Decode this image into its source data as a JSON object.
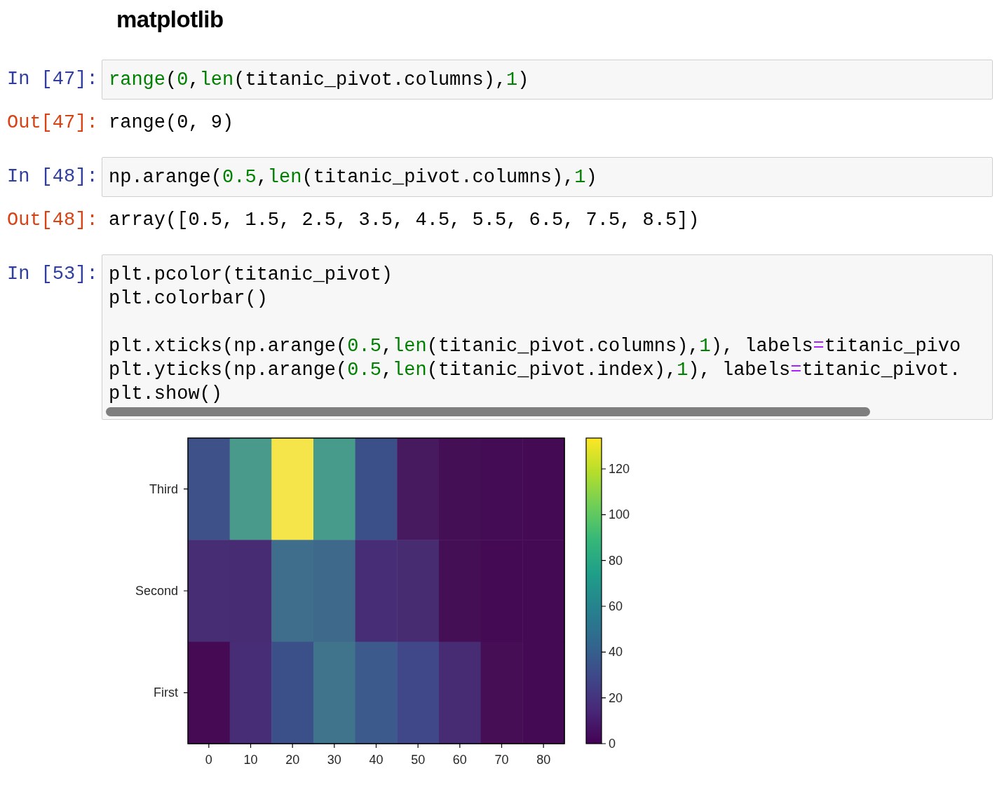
{
  "heading": "matplotlib",
  "cells": [
    {
      "prompt": "In [47]:",
      "code": [
        [
          [
            {
              "kind": "builtin",
              "text": "range"
            },
            {
              "kind": "plain",
              "text": "("
            },
            {
              "kind": "number",
              "text": "0"
            },
            {
              "kind": "plain",
              "text": ","
            },
            {
              "kind": "builtin",
              "text": "len"
            },
            {
              "kind": "plain",
              "text": "(titanic_pivot.columns),"
            },
            {
              "kind": "number",
              "text": "1"
            },
            {
              "kind": "plain",
              "text": ")"
            }
          ]
        ]
      ],
      "out_prompt": "Out[47]:",
      "output": "range(0, 9)"
    },
    {
      "prompt": "In [48]:",
      "code": [
        [
          [
            {
              "kind": "plain",
              "text": "np.arange("
            },
            {
              "kind": "number",
              "text": "0.5"
            },
            {
              "kind": "plain",
              "text": ","
            },
            {
              "kind": "builtin",
              "text": "len"
            },
            {
              "kind": "plain",
              "text": "(titanic_pivot.columns),"
            },
            {
              "kind": "number",
              "text": "1"
            },
            {
              "kind": "plain",
              "text": ")"
            }
          ]
        ]
      ],
      "out_prompt": "Out[48]:",
      "output": "array([0.5, 1.5, 2.5, 3.5, 4.5, 5.5, 6.5, 7.5, 8.5])"
    },
    {
      "prompt": "In [53]:",
      "code": [
        [
          [
            {
              "kind": "plain",
              "text": "plt.pcolor(titanic_pivot)"
            }
          ],
          [
            {
              "kind": "plain",
              "text": "plt.colorbar()"
            }
          ]
        ],
        [
          [
            {
              "kind": "plain",
              "text": "plt.xticks(np.arange("
            },
            {
              "kind": "number",
              "text": "0.5"
            },
            {
              "kind": "plain",
              "text": ","
            },
            {
              "kind": "builtin",
              "text": "len"
            },
            {
              "kind": "plain",
              "text": "(titanic_pivot.columns),"
            },
            {
              "kind": "number",
              "text": "1"
            },
            {
              "kind": "plain",
              "text": "), labels"
            },
            {
              "kind": "operator",
              "text": "="
            },
            {
              "kind": "plain",
              "text": "titanic_pivo"
            }
          ],
          [
            {
              "kind": "plain",
              "text": "plt.yticks(np.arange("
            },
            {
              "kind": "number",
              "text": "0.5"
            },
            {
              "kind": "plain",
              "text": ","
            },
            {
              "kind": "builtin",
              "text": "len"
            },
            {
              "kind": "plain",
              "text": "(titanic_pivot.index),"
            },
            {
              "kind": "number",
              "text": "1"
            },
            {
              "kind": "plain",
              "text": "), labels"
            },
            {
              "kind": "operator",
              "text": "="
            },
            {
              "kind": "plain",
              "text": "titanic_pivot."
            }
          ],
          [
            {
              "kind": "plain",
              "text": "plt.show()"
            }
          ]
        ]
      ],
      "heatmap": {
        "xticks": [
          "0",
          "10",
          "20",
          "30",
          "40",
          "50",
          "60",
          "70",
          "80"
        ],
        "rows": [
          {
            "label": "Third",
            "cells": [
              {
                "color": "#3e5289"
              },
              {
                "color": "#4a9a8c"
              },
              {
                "color": "#f5e54a"
              },
              {
                "color": "#479b8a"
              },
              {
                "color": "#3b4f88"
              },
              {
                "color": "#47195f"
              },
              {
                "color": "#440f55"
              },
              {
                "color": "#440c54"
              },
              {
                "color": "#440a53"
              }
            ]
          },
          {
            "label": "Second",
            "cells": [
              {
                "color": "#462d74"
              },
              {
                "color": "#472b73"
              },
              {
                "color": "#3f6e8c"
              },
              {
                "color": "#3f698b"
              },
              {
                "color": "#472d75"
              },
              {
                "color": "#482c72"
              },
              {
                "color": "#450f56"
              },
              {
                "color": "#440b54"
              },
              {
                "color": "#440a53"
              }
            ]
          },
          {
            "label": "First",
            "cells": [
              {
                "color": "#460a55"
              },
              {
                "color": "#472d75"
              },
              {
                "color": "#3b4f88"
              },
              {
                "color": "#3f748c"
              },
              {
                "color": "#3c5b8c"
              },
              {
                "color": "#41488a"
              },
              {
                "color": "#472b73"
              },
              {
                "color": "#450e55"
              },
              {
                "color": "#440a53"
              }
            ]
          }
        ],
        "colorbar_ticks": [
          "120",
          "100",
          "80",
          "60",
          "40",
          "20",
          "0"
        ]
      }
    }
  ]
}
